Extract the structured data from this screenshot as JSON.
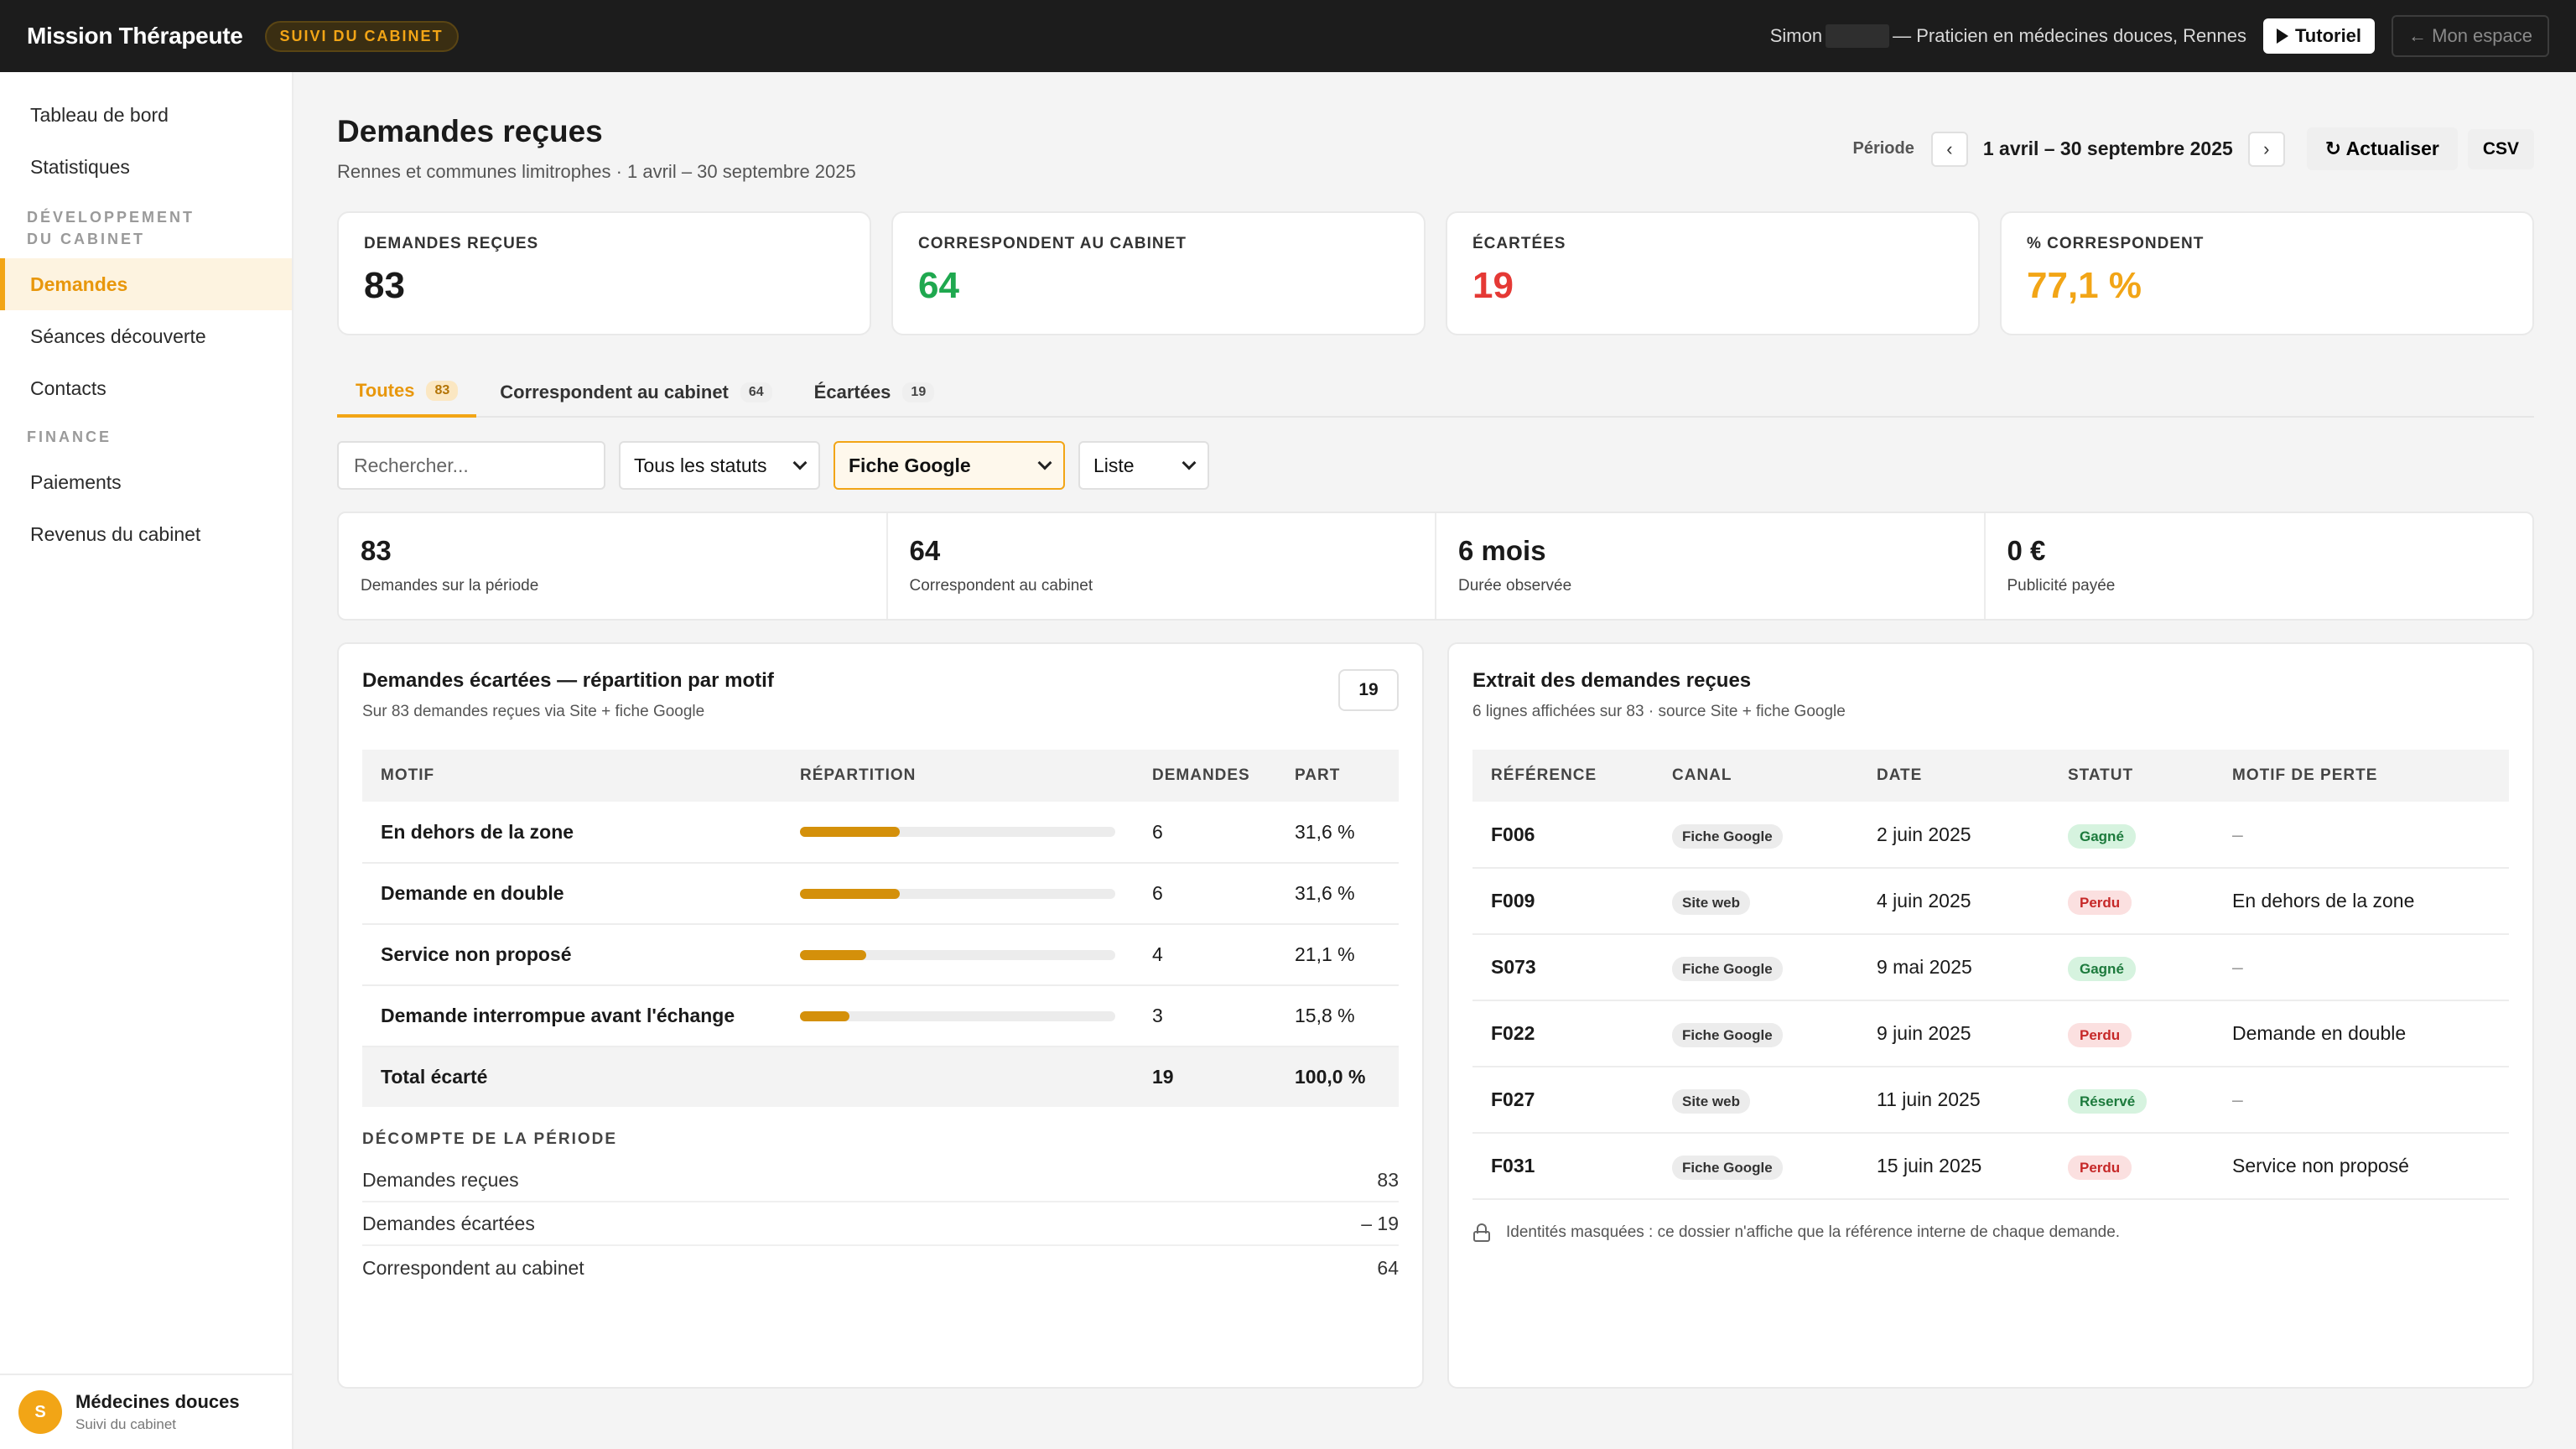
{
  "app": {
    "brand": "Mission Thérapeute",
    "badge": "SUIVI DU CABINET"
  },
  "header": {
    "user_first": "Simon",
    "user_rest": "— Praticien en médecines douces, Rennes",
    "tutorial_label": "Tutoriel",
    "space_label": "← Mon espace"
  },
  "sidebar": {
    "items_top": [
      {
        "label": "Tableau de bord"
      },
      {
        "label": "Statistiques"
      }
    ],
    "section_dev": "DÉVELOPPEMENT DU CABINET",
    "items_dev": [
      {
        "label": "Demandes",
        "active": true
      },
      {
        "label": "Séances découverte"
      },
      {
        "label": "Contacts"
      }
    ],
    "section_finance": "FINANCE",
    "items_finance": [
      {
        "label": "Paiements"
      },
      {
        "label": "Revenus du cabinet"
      }
    ],
    "footer": {
      "avatar": "S",
      "title": "Médecines douces",
      "subtitle": "Suivi du cabinet"
    }
  },
  "page": {
    "title": "Demandes reçues",
    "subtitle": "Rennes et communes limitrophes · 1 avril – 30 septembre 2025",
    "period_label": "Période",
    "prev": "‹",
    "next": "›",
    "period_value": "1 avril – 30 septembre 2025",
    "refresh_label": "↻ Actualiser",
    "csv_label": "CSV"
  },
  "kpis": [
    {
      "label": "DEMANDES REÇUES",
      "value": "83",
      "color": "#1a1a1a"
    },
    {
      "label": "CORRESPONDENT AU CABINET",
      "value": "64",
      "color": "#1fa84f"
    },
    {
      "label": "ÉCARTÉES",
      "value": "19",
      "color": "#e53935"
    },
    {
      "label": "% CORRESPONDENT",
      "value": "77,1 %",
      "color": "#f2a516"
    }
  ],
  "tabs": [
    {
      "label": "Toutes",
      "count": "83"
    },
    {
      "label": "Correspondent au cabinet",
      "count": "64"
    },
    {
      "label": "Écartées",
      "count": "19"
    }
  ],
  "filters": {
    "search_placeholder": "Rechercher...",
    "status": "Tous les statuts",
    "source": "Fiche Google",
    "view": "Liste"
  },
  "summary": [
    {
      "value": "83",
      "label": "Demandes sur la période"
    },
    {
      "value": "64",
      "label": "Correspondent au cabinet"
    },
    {
      "value": "6 mois",
      "label": "Durée observée"
    },
    {
      "value": "0 €",
      "label": "Publicité payée"
    }
  ],
  "rejected": {
    "title": "Demandes écartées — répartition par motif",
    "subtitle": "Sur 83 demandes reçues via Site + fiche Google",
    "badge": "19",
    "headers": {
      "motif": "MOTIF",
      "repartition": "RÉPARTITION",
      "demandes": "DEMANDES",
      "part": "PART"
    },
    "rows": [
      {
        "motif": "En dehors de la zone",
        "demandes": "6",
        "part": "31,6 %",
        "share": 0.316
      },
      {
        "motif": "Demande en double",
        "demandes": "6",
        "part": "31,6 %",
        "share": 0.316
      },
      {
        "motif": "Service non proposé",
        "demandes": "4",
        "part": "21,1 %",
        "share": 0.211
      },
      {
        "motif": "Demande interrompue avant l'échange",
        "demandes": "3",
        "part": "15,8 %",
        "share": 0.158
      }
    ],
    "total": {
      "label": "Total écarté",
      "demandes": "19",
      "part": "100,0 %"
    },
    "decompte_title": "DÉCOMPTE DE LA PÉRIODE",
    "decompte": [
      {
        "label": "Demandes reçues",
        "value": "83"
      },
      {
        "label": "Demandes écartées",
        "value": "– 19"
      },
      {
        "label": "Correspondent au cabinet",
        "value": "64"
      }
    ]
  },
  "extract": {
    "title": "Extrait des demandes reçues",
    "subtitle": "6 lignes affichées sur 83 · source Site + fiche Google",
    "headers": {
      "ref": "RÉFÉRENCE",
      "canal": "CANAL",
      "date": "DATE",
      "statut": "STATUT",
      "motif": "MOTIF DE PERTE"
    },
    "rows": [
      {
        "ref": "F006",
        "canal": "Fiche Google",
        "date": "2 juin 2025",
        "statut": "Gagné",
        "motif": "–"
      },
      {
        "ref": "F009",
        "canal": "Site web",
        "date": "4 juin 2025",
        "statut": "Perdu",
        "motif": "En dehors de la zone"
      },
      {
        "ref": "S073",
        "canal": "Fiche Google",
        "date": "9 mai 2025",
        "statut": "Gagné",
        "motif": "–"
      },
      {
        "ref": "F022",
        "canal": "Fiche Google",
        "date": "9 juin 2025",
        "statut": "Perdu",
        "motif": "Demande en double"
      },
      {
        "ref": "F027",
        "canal": "Site web",
        "date": "11 juin 2025",
        "statut": "Réservé",
        "motif": "–"
      },
      {
        "ref": "F031",
        "canal": "Fiche Google",
        "date": "15 juin 2025",
        "statut": "Perdu",
        "motif": "Service non proposé"
      }
    ],
    "status_colors": {
      "Gagné": {
        "bg": "#d6f3df",
        "fg": "#1c7a3c"
      },
      "Perdu": {
        "bg": "#fbe0e0",
        "fg": "#c62828"
      },
      "Réservé": {
        "bg": "#d6f3df",
        "fg": "#1c7a3c"
      }
    },
    "privacy_note": "Identités masquées : ce dossier n'affiche que la référence interne de chaque demande."
  }
}
